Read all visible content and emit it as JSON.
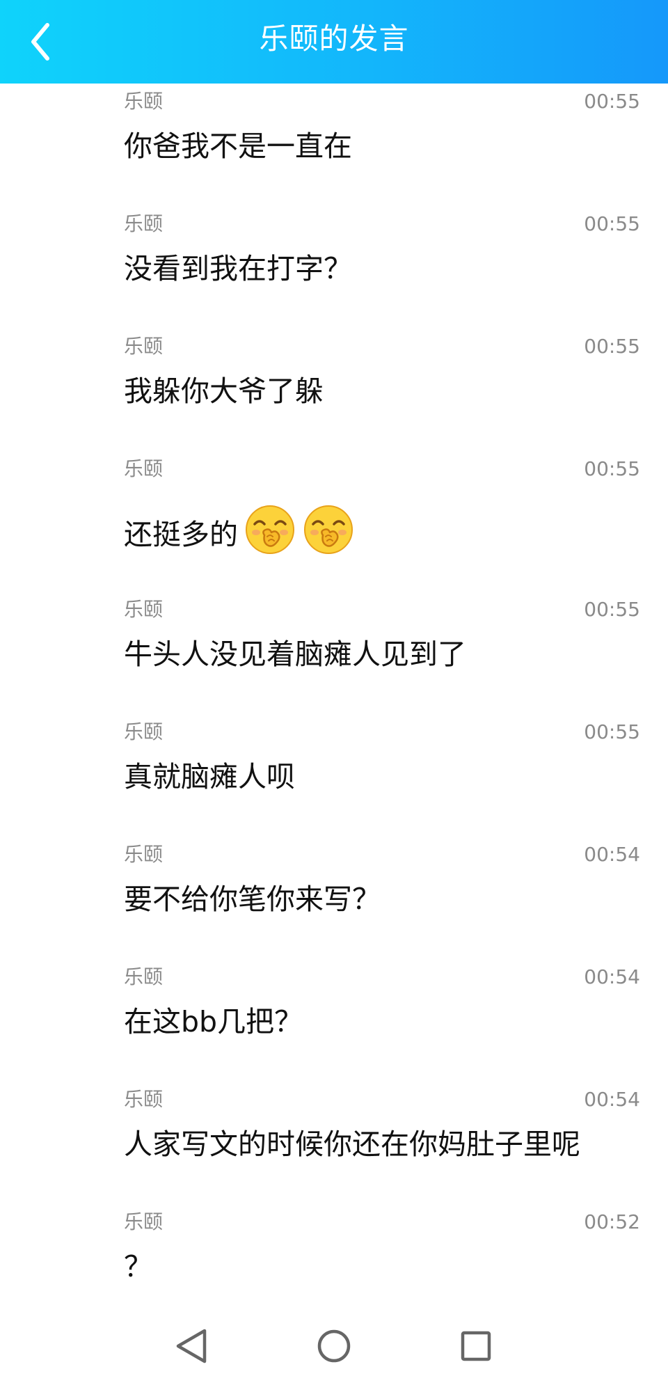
{
  "header": {
    "title": "乐颐的发言",
    "background_colors": [
      "#0fd3fb",
      "#1598fa"
    ],
    "back_icon": "chevron-left-icon"
  },
  "messages": [
    {
      "author": "乐颐",
      "time": "00:55",
      "text": "你爸我不是一直在"
    },
    {
      "author": "乐颐",
      "time": "00:55",
      "text": "没看到我在打字？"
    },
    {
      "author": "乐颐",
      "time": "00:55",
      "text": "我躲你大爷了躲"
    },
    {
      "author": "乐颐",
      "time": "00:55",
      "text": "还挺多的",
      "emojis": [
        "giggle-emoji",
        "giggle-emoji"
      ]
    },
    {
      "author": "乐颐",
      "time": "00:55",
      "text": "牛头人没见着脑瘫人见到了"
    },
    {
      "author": "乐颐",
      "time": "00:55",
      "text": "真就脑瘫人呗"
    },
    {
      "author": "乐颐",
      "time": "00:54",
      "text": "要不给你笔你来写？"
    },
    {
      "author": "乐颐",
      "time": "00:54",
      "text": "在这bb几把？"
    },
    {
      "author": "乐颐",
      "time": "00:54",
      "text": "人家写文的时候你还在你妈肚子里呢"
    },
    {
      "author": "乐颐",
      "time": "00:52",
      "text": "？"
    }
  ],
  "nav_bar": {
    "back_icon": "triangle-back-icon",
    "home_icon": "circle-home-icon",
    "recents_icon": "square-recents-icon",
    "icon_color": "#666666"
  }
}
